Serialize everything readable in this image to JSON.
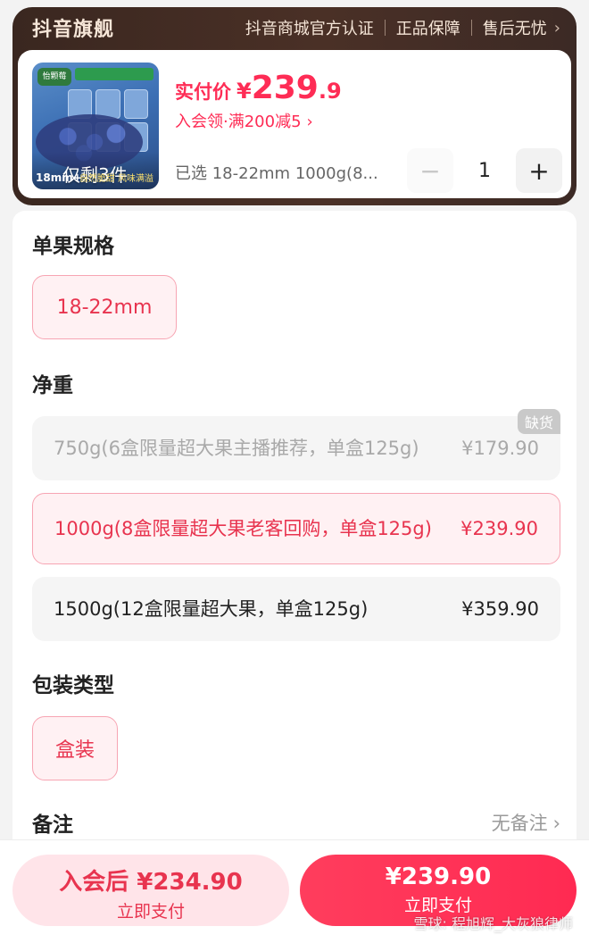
{
  "header": {
    "store_title": "抖音旗舰",
    "badges": [
      "抖音商城官方认证",
      "正品保障",
      "售后无忧"
    ],
    "chevron": "›"
  },
  "product": {
    "thumbnail_icon": "blueberry-box-image",
    "thumbnail_brand": "怡颗莓",
    "thumbnail_size_tag": "18mm+",
    "thumbnail_slogan": "自然脆甜 风味满溢",
    "stock_text": "仅剩3件",
    "price_label": "实付价",
    "price_symbol": "¥",
    "price_integer": "239",
    "price_decimal": ".9",
    "promo_text": "入会领·满200减5",
    "promo_chevron": "›",
    "selected_text": "已选 18-22mm 1000g(8...",
    "quantity": "1",
    "minus_label": "−",
    "plus_label": "+"
  },
  "specs": {
    "size_title": "单果规格",
    "size_options": [
      "18-22mm"
    ],
    "weight_title": "净重",
    "weight_options": [
      {
        "label": "750g(6盒限量超大果主播推荐，单盒125g)",
        "price": "¥179.90",
        "state": "disabled",
        "badge": "缺货"
      },
      {
        "label": "1000g(8盒限量超大果老客回购，单盒125g)",
        "price": "¥239.90",
        "state": "selected"
      },
      {
        "label": "1500g(12盒限量超大果，单盒125g)",
        "price": "¥359.90",
        "state": "normal"
      }
    ],
    "package_title": "包装类型",
    "package_options": [
      "盒装"
    ],
    "remark_label": "备注",
    "remark_value": "无备注",
    "remark_chevron": "›"
  },
  "bottom_bar": {
    "member_price": "入会后 ¥234.90",
    "member_action": "立即支付",
    "main_price": "¥239.90",
    "main_action": "立即支付",
    "watermark": "雪球: 程旭辉_大灰狼律师"
  },
  "colors": {
    "accent": "#fe2c55",
    "brand_bar": "#3a2720",
    "chip_bg": "#fff1f3",
    "chip_border": "#f7a5b3"
  }
}
